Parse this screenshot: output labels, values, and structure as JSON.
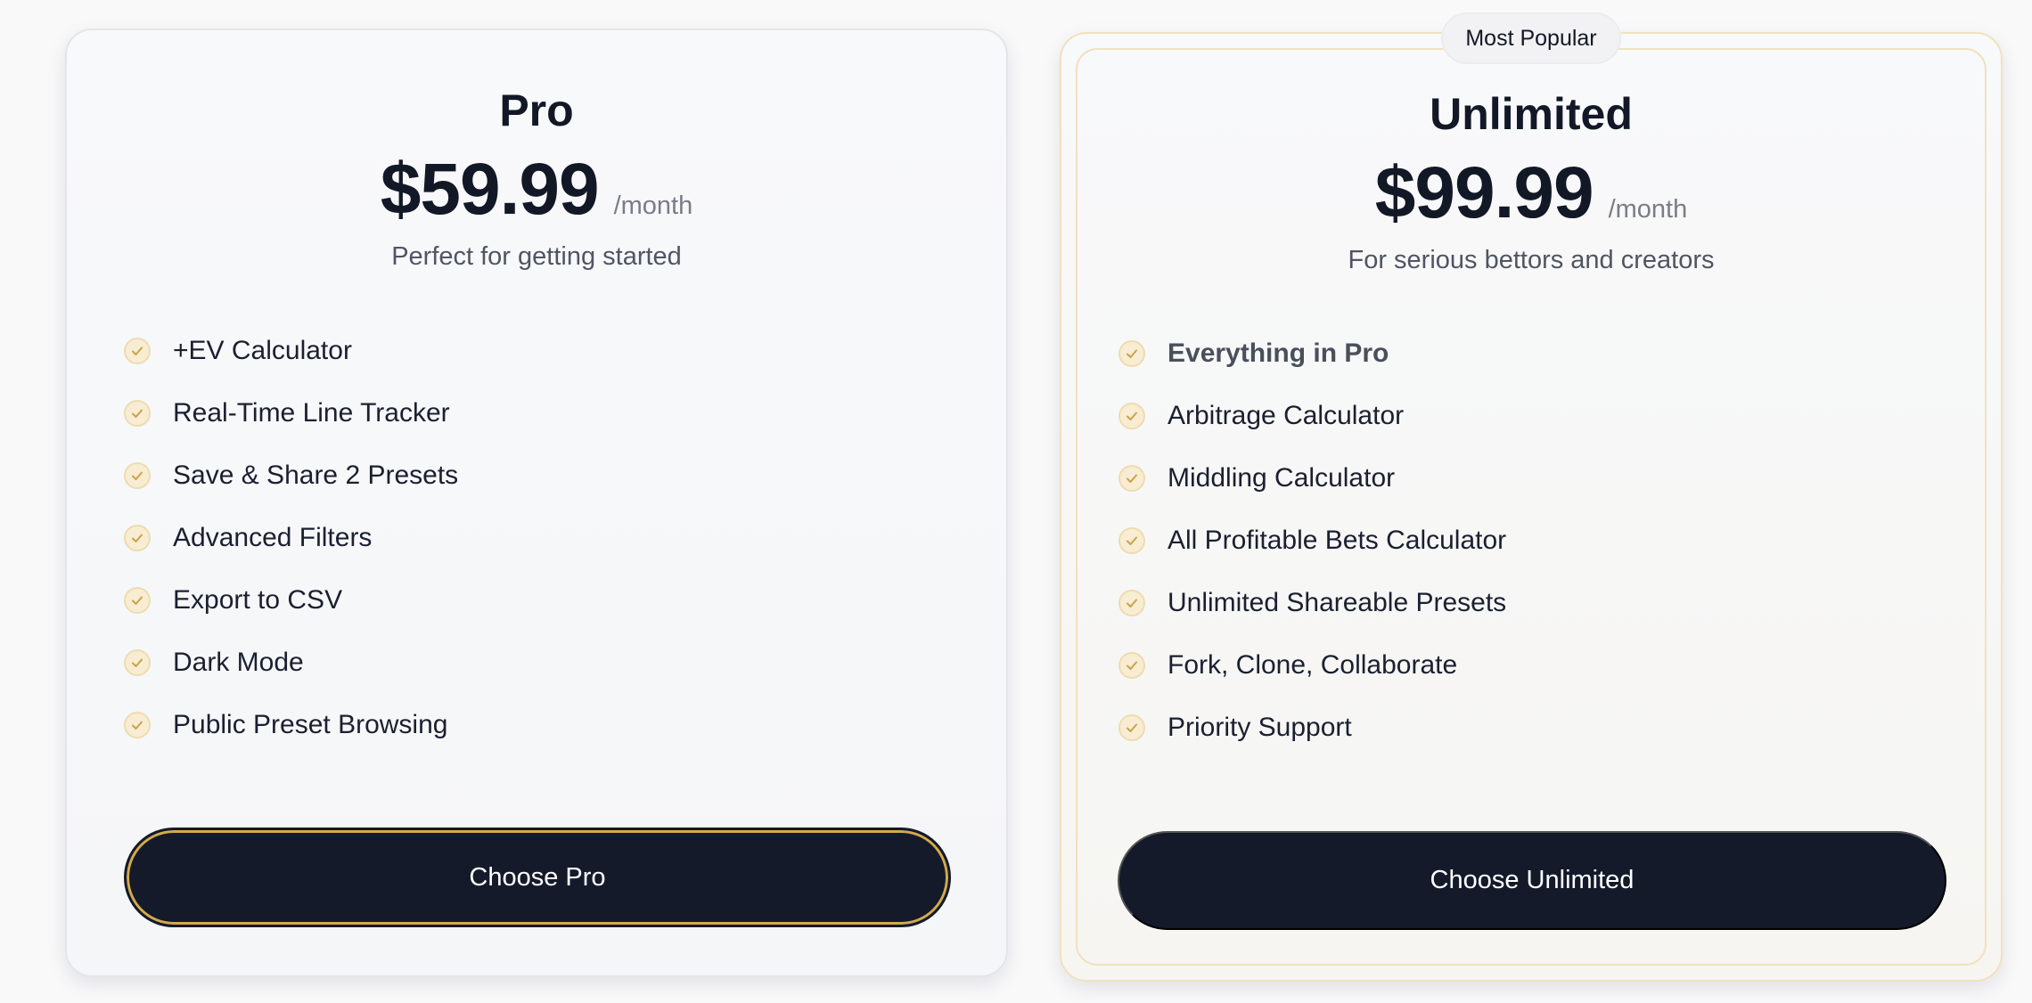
{
  "plans": [
    {
      "name": "Pro",
      "price": "$59.99",
      "period": "/month",
      "tagline": "Perfect for getting started",
      "features": [
        "+EV Calculator",
        "Real-Time Line Tracker",
        "Save & Share 2 Presets",
        "Advanced Filters",
        "Export to CSV",
        "Dark Mode",
        "Public Preset Browsing"
      ],
      "cta_label": "Choose Pro"
    },
    {
      "name": "Unlimited",
      "badge": "Most Popular",
      "price": "$99.99",
      "period": "/month",
      "tagline": "For serious bettors and creators",
      "features": [
        "Everything in Pro",
        "Arbitrage Calculator",
        "Middling Calculator",
        "All Profitable Bets Calculator",
        "Unlimited Shareable Presets",
        "Fork, Clone, Collaborate",
        "Priority Support"
      ],
      "cta_label": "Choose Unlimited"
    }
  ],
  "colors": {
    "accent_gold": "#d4aa4c",
    "button_dark": "#141a2a",
    "text_primary": "#131827",
    "text_muted": "#7a7d87"
  },
  "icons": {
    "feature_check": "check-circle-icon"
  }
}
